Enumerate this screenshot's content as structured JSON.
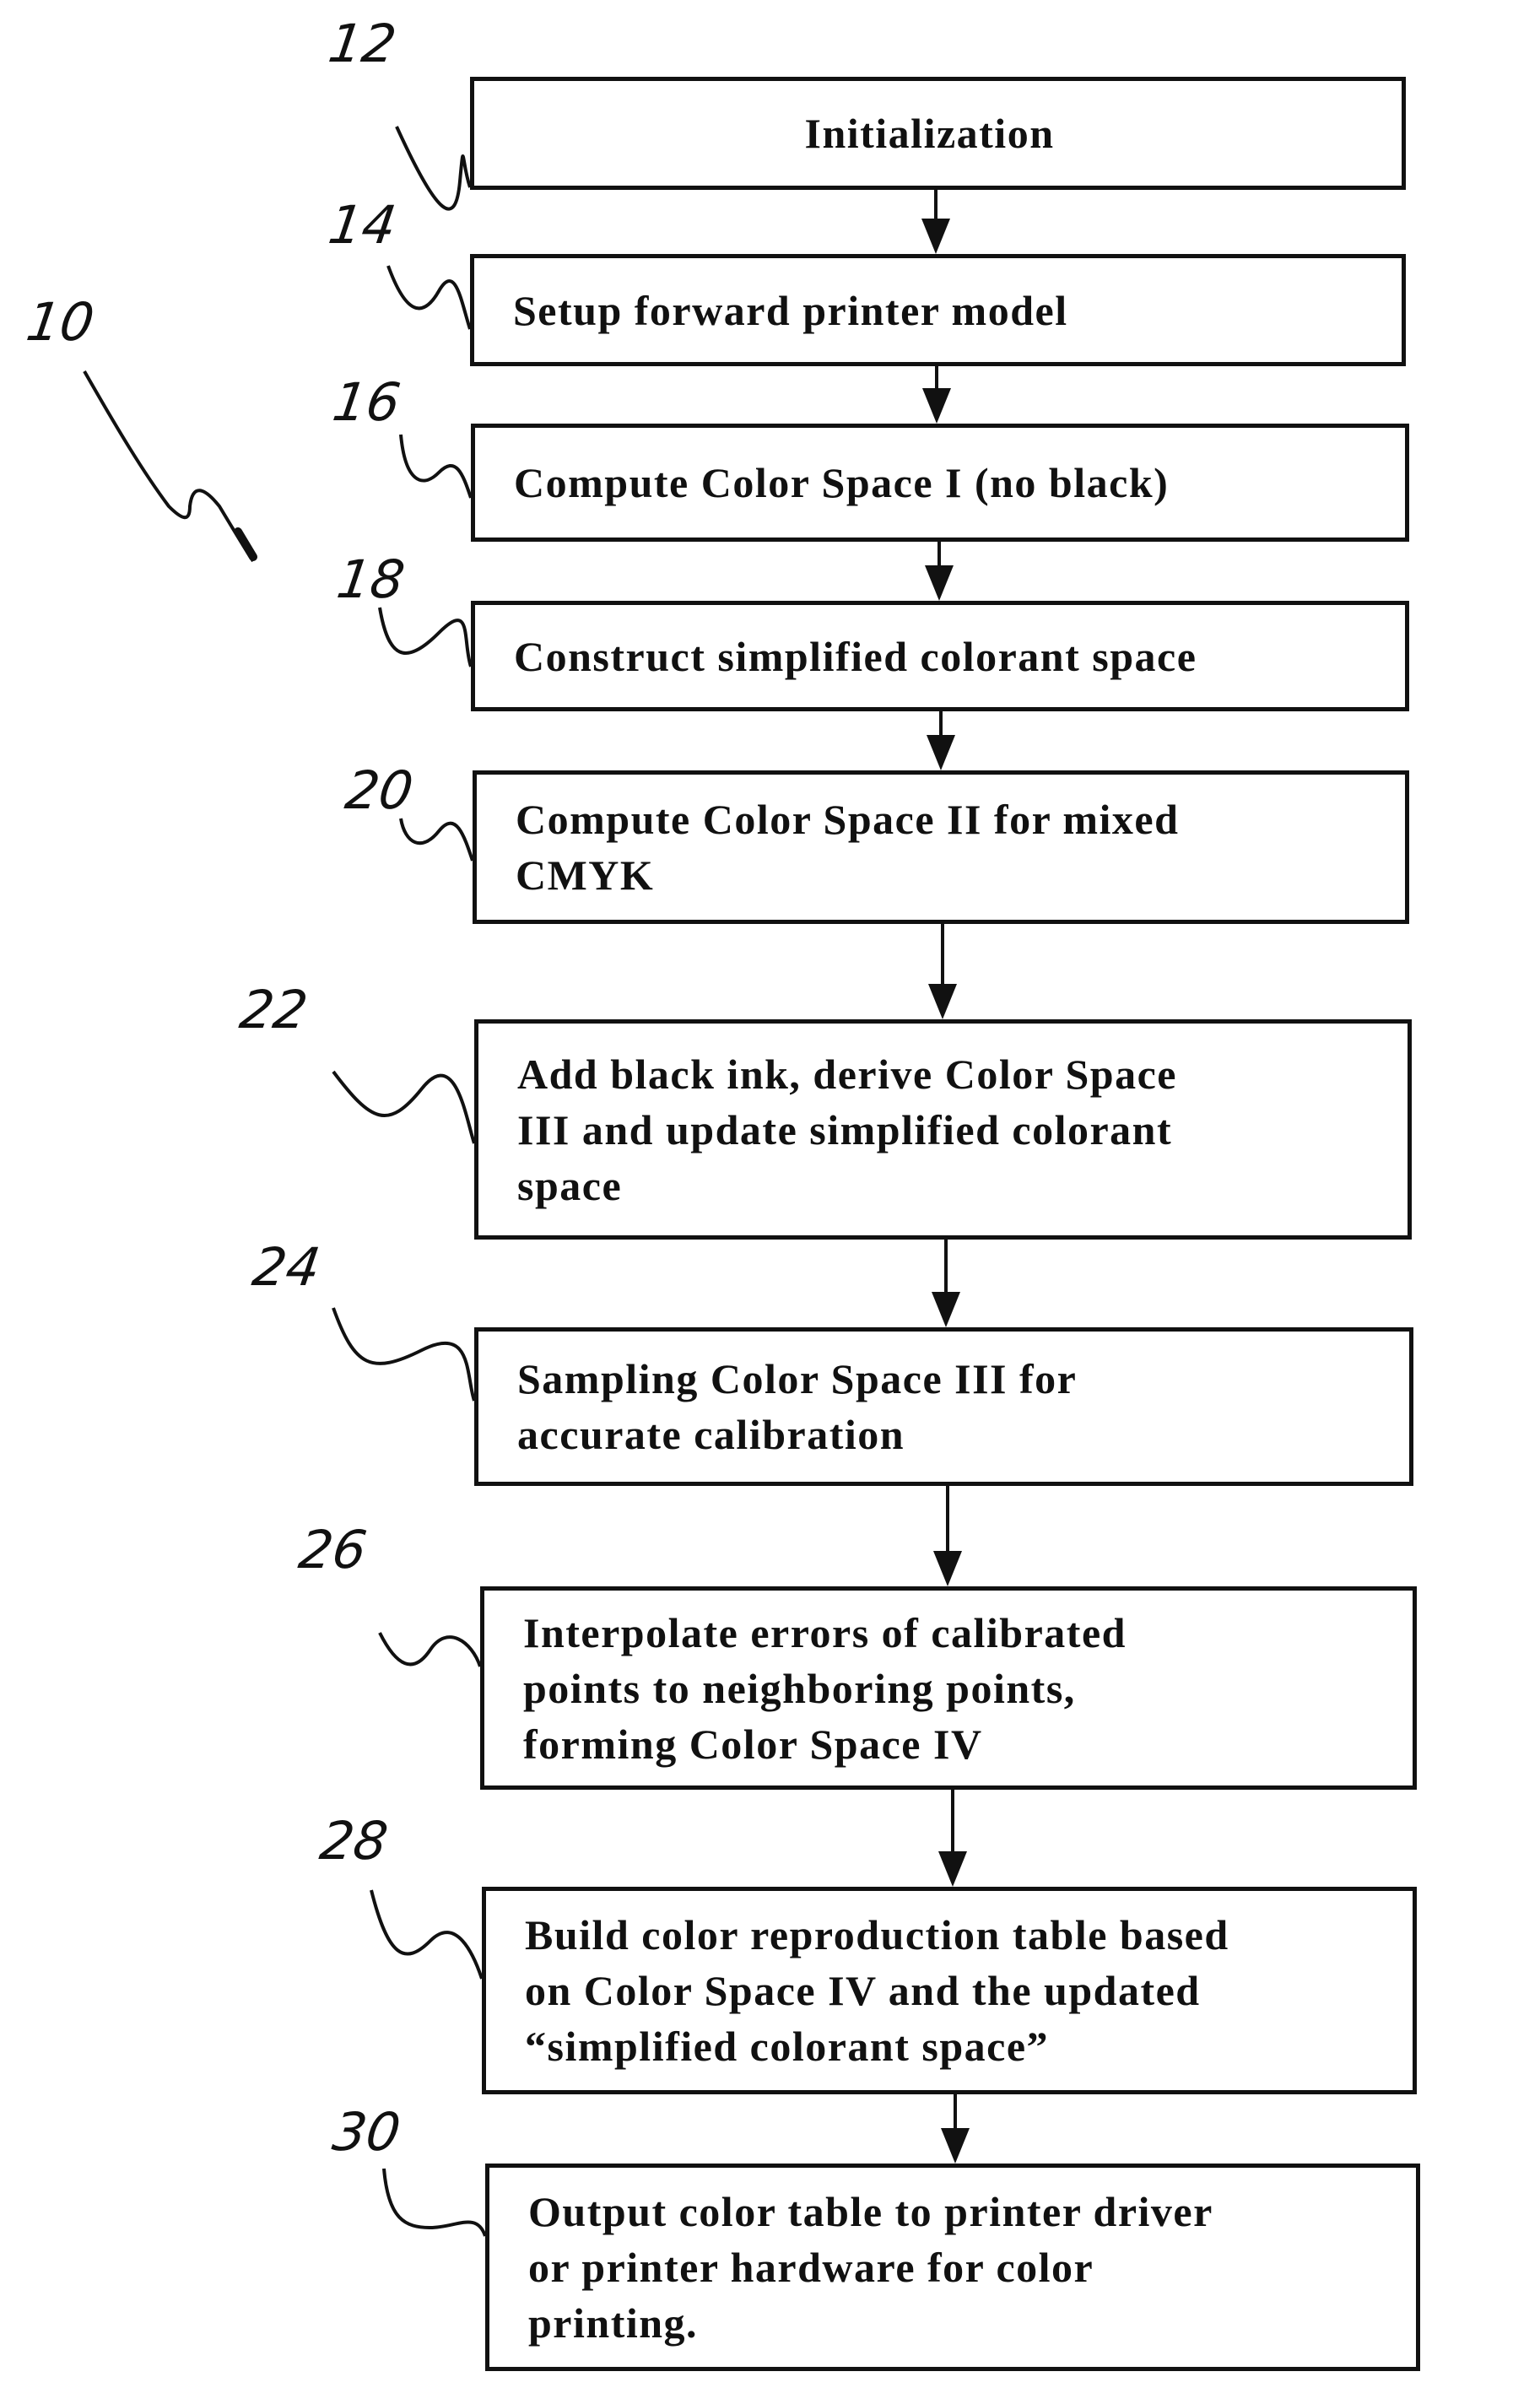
{
  "figure": {
    "reference": "10",
    "steps": [
      {
        "ref": "12",
        "label": "Initialization"
      },
      {
        "ref": "14",
        "label": "Setup forward printer model"
      },
      {
        "ref": "16",
        "label": "Compute Color Space I (no black)"
      },
      {
        "ref": "18",
        "label": "Construct simplified colorant space"
      },
      {
        "ref": "20",
        "label": "Compute Color Space II for mixed\nCMYK"
      },
      {
        "ref": "22",
        "label": "Add black ink, derive Color Space\nIII and update simplified colorant\nspace"
      },
      {
        "ref": "24",
        "label": "Sampling Color Space III for\naccurate calibration"
      },
      {
        "ref": "26",
        "label": "Interpolate errors of calibrated\npoints to neighboring points,\nforming Color Space IV"
      },
      {
        "ref": "28",
        "label": "Build color reproduction table based\non Color Space IV and the updated\n“simplified colorant space”"
      },
      {
        "ref": "30",
        "label": "Output color table to printer driver\nor printer hardware for color\nprinting."
      }
    ]
  }
}
